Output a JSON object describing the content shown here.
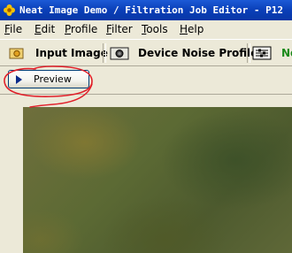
{
  "window": {
    "title": "Neat Image Demo / Filtration Job Editor - P12"
  },
  "menu": [
    {
      "label": "File"
    },
    {
      "label": "Edit"
    },
    {
      "label": "Profile"
    },
    {
      "label": "Filter"
    },
    {
      "label": "Tools"
    },
    {
      "label": "Help"
    }
  ],
  "tabs": [
    {
      "label": "Input Image",
      "icon": "folder-image-icon"
    },
    {
      "label": "Device Noise Profile",
      "icon": "camera-icon"
    },
    {
      "label": "No",
      "icon": "sliders-icon",
      "color": "#1a8a1a"
    }
  ],
  "toolbar": {
    "preview_label": "Preview"
  },
  "annotation": {
    "color": "#e0202a"
  }
}
